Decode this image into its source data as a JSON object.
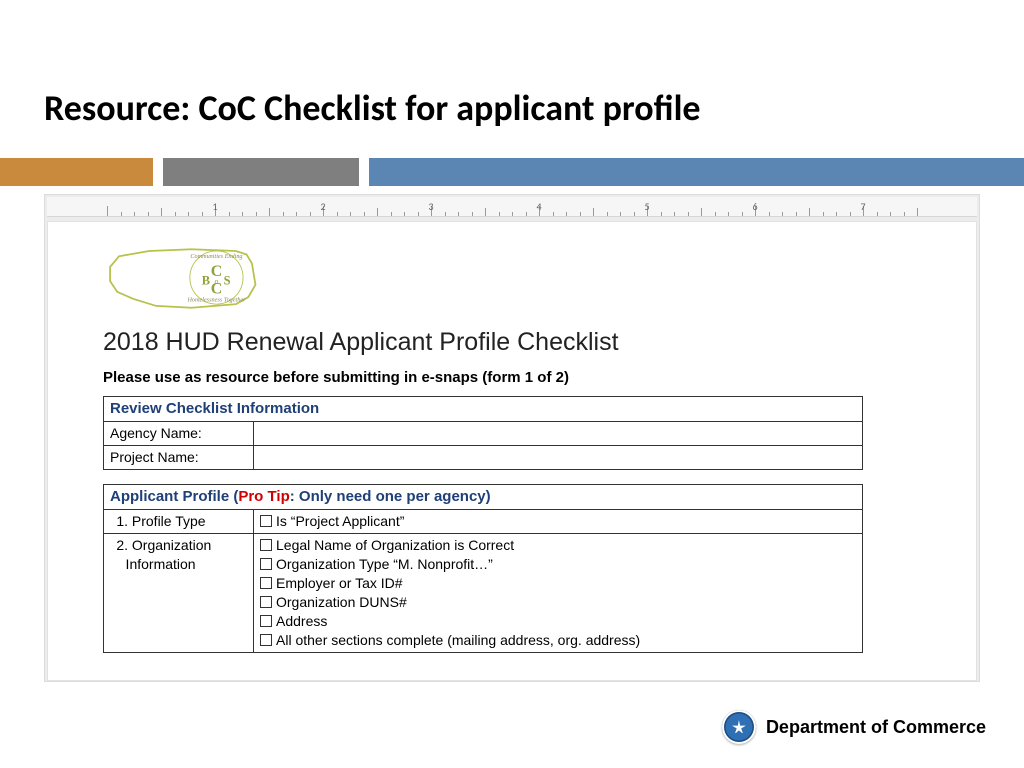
{
  "slide": {
    "title": "Resource: CoC Checklist for applicant profile"
  },
  "bars": {
    "orange": "#c98a3e",
    "gray": "#7f7f7f",
    "blue": "#5b85b3"
  },
  "ruler": {
    "labels": [
      "1",
      "2",
      "3",
      "4",
      "5",
      "6",
      "7"
    ]
  },
  "doc": {
    "logo_text_top": "Communities Ending",
    "logo_text_bottom": "Homelessness Together",
    "logo_letters": "BoSC",
    "title": "2018 HUD Renewal Applicant Profile Checklist",
    "subtitle": "Please use as resource before submitting in e-snaps (form 1 of 2)"
  },
  "review_table": {
    "header": "Review Checklist Information",
    "rows": [
      {
        "label": "Agency Name:",
        "value": ""
      },
      {
        "label": "Project Name:",
        "value": ""
      }
    ]
  },
  "profile_table": {
    "header_prefix": "Applicant Profile (",
    "header_protip": "Pro Tip",
    "header_suffix": ": Only need one per agency)",
    "rows": [
      {
        "num": "1.",
        "label": "Profile Type",
        "items": [
          "Is “Project Applicant”"
        ]
      },
      {
        "num": "2.",
        "label": "Organization Information",
        "items": [
          "Legal Name of Organization is Correct",
          "Organization Type “M. Nonprofit…”",
          "Employer or Tax ID#",
          "Organization DUNS#",
          "Address",
          "All other sections complete (mailing address, org. address)"
        ]
      }
    ]
  },
  "footer": {
    "brand": "Department of Commerce"
  }
}
